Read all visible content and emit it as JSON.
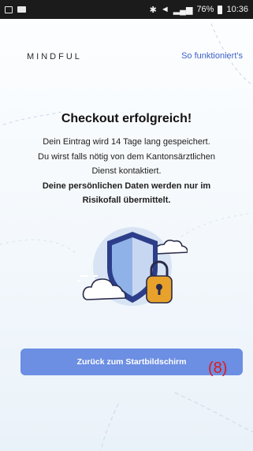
{
  "status_bar": {
    "battery": "76%",
    "time": "10:36"
  },
  "header": {
    "logo": "MINDFUL",
    "how_it_works": "So funktioniert's"
  },
  "main": {
    "title": "Checkout erfolgreich!",
    "line1": "Dein Eintrag wird 14 Tage lang gespeichert.",
    "line2": "Du wirst falls nötig von dem Kantonsärztlichen",
    "line3": "Dienst kontaktiert.",
    "line4": "Deine persönlichen Daten werden nur im",
    "line5": "Risikofall übermittelt."
  },
  "button": {
    "label": "Zurück zum Startbildschirm"
  },
  "annotation": {
    "label": "(8)"
  },
  "colors": {
    "accent": "#6c8ee3",
    "link": "#3d62c9",
    "marker": "#dd1c1c"
  }
}
